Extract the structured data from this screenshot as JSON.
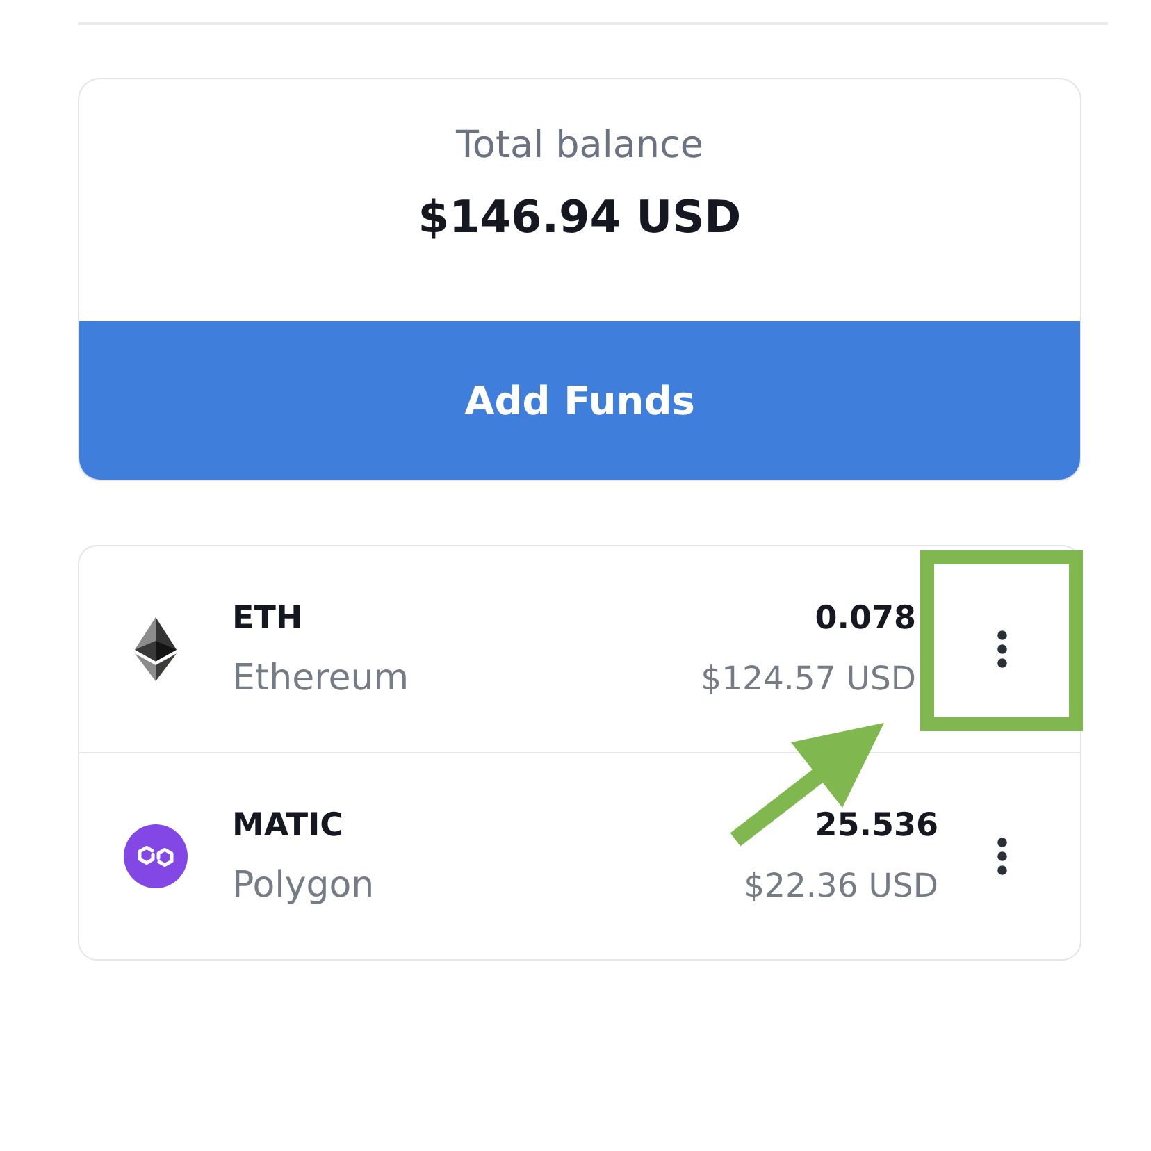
{
  "balance": {
    "label": "Total balance",
    "amount": "$146.94 USD"
  },
  "add_funds_button": {
    "label": "Add Funds"
  },
  "tokens": [
    {
      "kind": "eth",
      "symbol": "ETH",
      "name": "Ethereum",
      "amount": "0.078",
      "fiat": "$124.57 USD",
      "highlighted": true
    },
    {
      "kind": "polygon",
      "symbol": "MATIC",
      "name": "Polygon",
      "amount": "25.536",
      "fiat": "$22.36 USD",
      "highlighted": false
    }
  ]
}
